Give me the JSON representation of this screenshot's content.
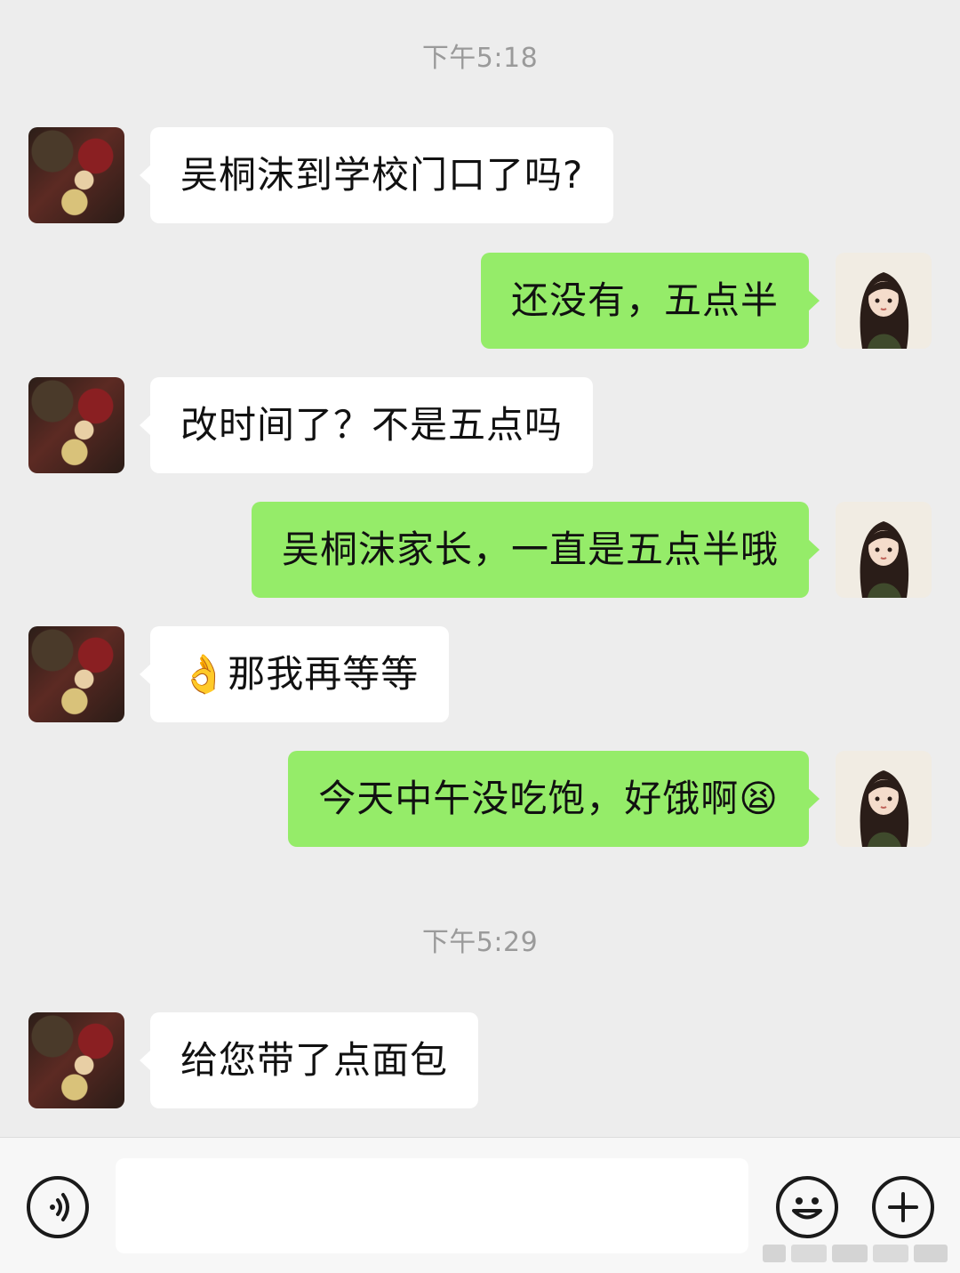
{
  "conversation": {
    "timestamps": [
      "下午5:18",
      "下午5:29"
    ],
    "messages": [
      {
        "side": "left",
        "text": "吴桐沫到学校门口了吗?"
      },
      {
        "side": "right",
        "text": "还没有，五点半"
      },
      {
        "side": "left",
        "text": "改时间了？不是五点吗"
      },
      {
        "side": "right",
        "text": "吴桐沫家长，一直是五点半哦"
      },
      {
        "side": "left",
        "text": "👌那我再等等"
      },
      {
        "side": "right",
        "text": "今天中午没吃饱，好饿啊😫"
      },
      {
        "side": "left",
        "text": "给您带了点面包"
      }
    ]
  },
  "input_bar": {
    "input_value": "",
    "icons": [
      "voice-icon",
      "emoji-icon",
      "plus-icon"
    ]
  },
  "colors": {
    "background": "#ededed",
    "incoming_bubble": "#ffffff",
    "outgoing_bubble": "#95ec69",
    "timestamp_text": "#9a9a9a",
    "input_bar": "#f7f7f7"
  }
}
